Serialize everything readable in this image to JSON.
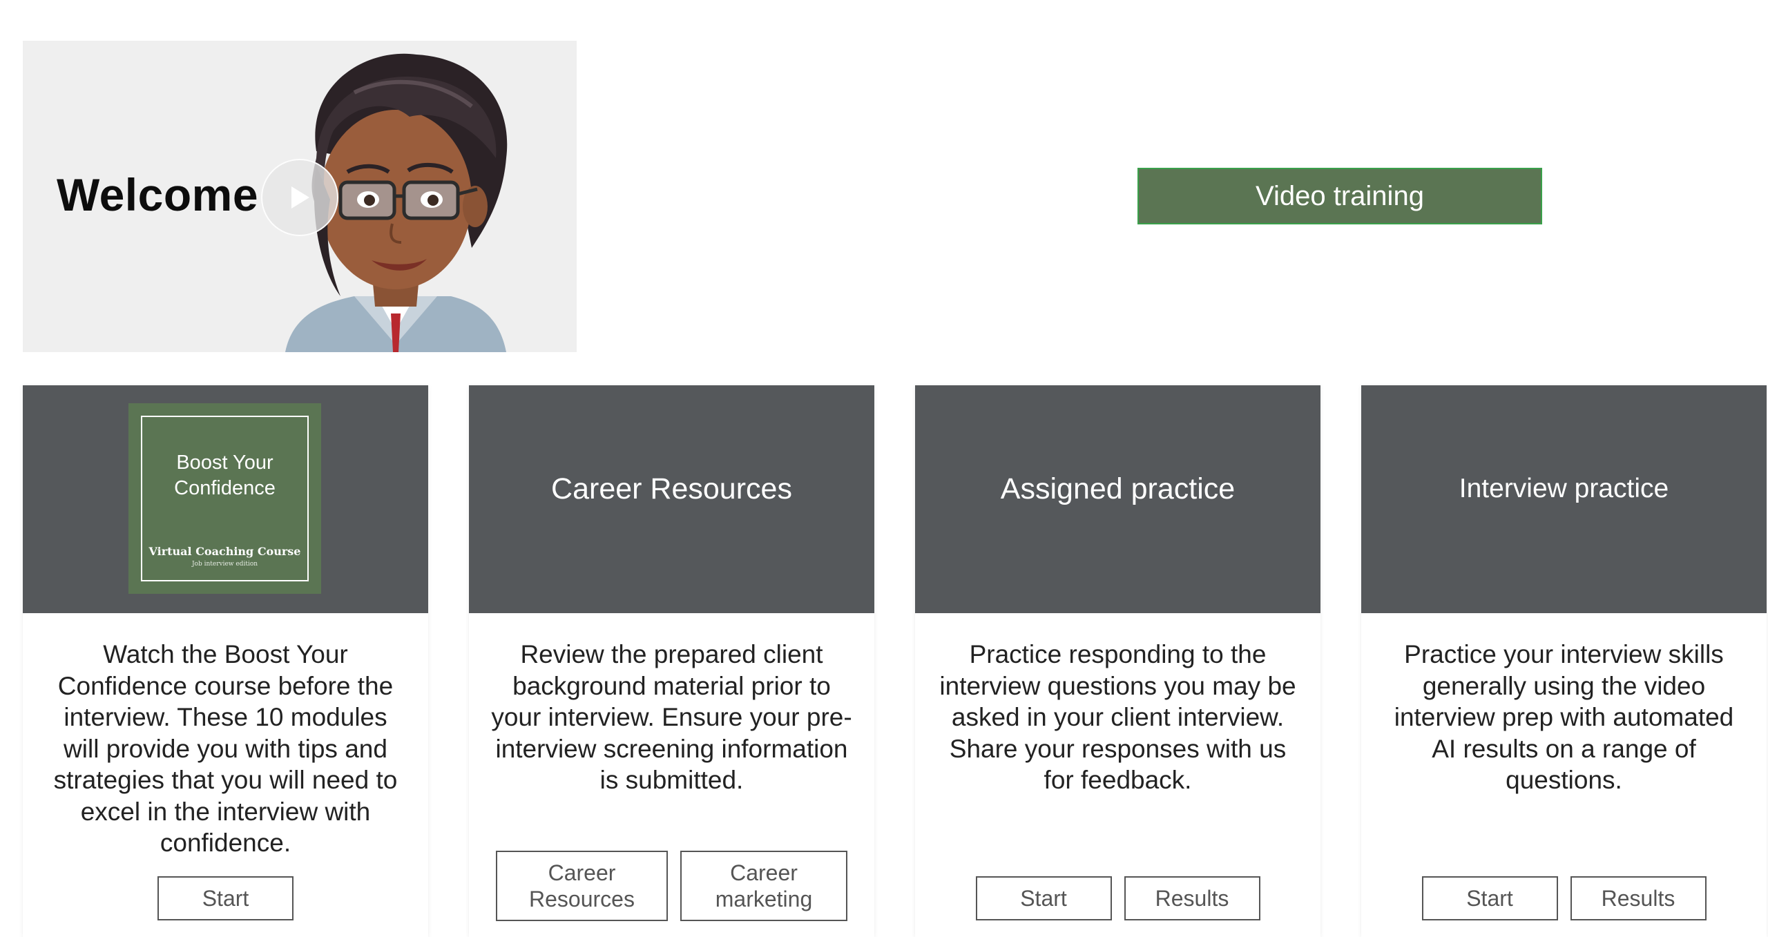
{
  "welcome": {
    "title": "Welcome",
    "play_icon": "play-icon"
  },
  "video_training": {
    "label": "Video training"
  },
  "colors": {
    "accent_green": "#5b7553",
    "card_header": "#55585b",
    "button_border": "#555555"
  },
  "cards": [
    {
      "thumbnail": {
        "title": "Boost Your Confidence",
        "subtitle": "Virtual Coaching Course",
        "edition": "Job interview edition"
      },
      "description": "Watch the Boost Your Confidence course before the interview. These 10 modules will provide you with tips and strategies that you will need to excel in the interview with confidence.",
      "buttons": [
        "Start"
      ]
    },
    {
      "title": "Career Resources",
      "description": "Review the prepared client background material prior to your interview. Ensure your pre-interview screening information is submitted.",
      "buttons": [
        "Career Resources",
        "Career marketing"
      ]
    },
    {
      "title": "Assigned practice",
      "description": "Practice responding to the interview questions you may be asked in your client interview. Share your responses with us for feedback.",
      "buttons": [
        "Start",
        "Results"
      ]
    },
    {
      "title": "Interview practice",
      "description": "Practice your interview skills generally using the video interview prep with automated AI results on a range of questions.",
      "buttons": [
        "Start",
        "Results"
      ]
    }
  ]
}
